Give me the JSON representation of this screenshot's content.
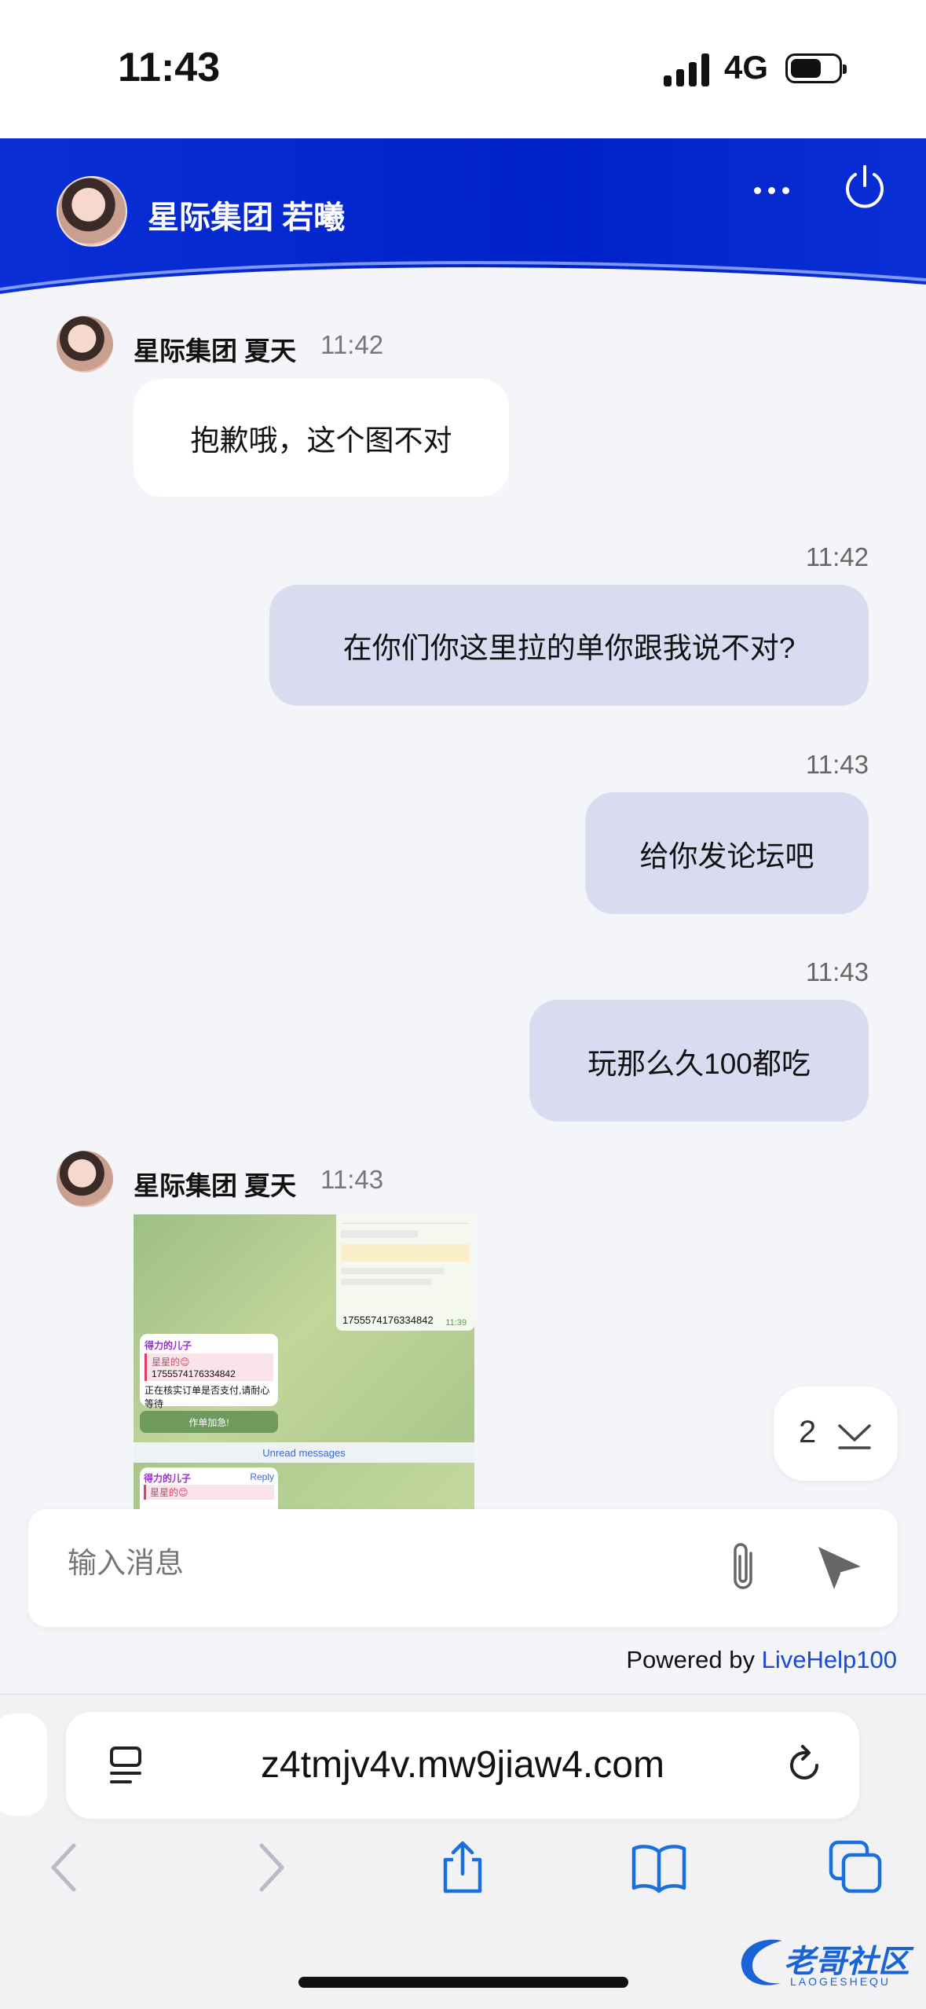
{
  "status_bar": {
    "time": "11:43",
    "network": "4G"
  },
  "header": {
    "title": "星际集团 若曦"
  },
  "messages": [
    {
      "sender": "星际集团 夏天",
      "time": "11:42",
      "text": "抱歉哦，这个图不对"
    },
    {
      "time": "11:42",
      "text": "在你们你这里拉的单你跟我说不对?"
    },
    {
      "time": "11:43",
      "text": "给你发论坛吧"
    },
    {
      "time": "11:43",
      "text": "玩那么久100都吃"
    },
    {
      "sender": "星际集团 夏天",
      "time": "11:43"
    }
  ],
  "image_message": {
    "number": "1755574176334842",
    "card_time": "11:39",
    "group_name": "得力的儿子",
    "quote_name": "星星的😊",
    "quote_number": "1755574176334842",
    "body": "正在核实订单是否支付,请耐心等待",
    "body_number": "1755574176334842",
    "button": "作单加急!",
    "unread": "Unread messages",
    "reply": "Reply"
  },
  "unread_badge": {
    "count": "2"
  },
  "input": {
    "placeholder": "输入消息"
  },
  "footer": {
    "powered_prefix": "Powered by ",
    "powered_link": "LiveHelp100"
  },
  "browser": {
    "url": "z4tmjv4v.mw9jiaw4.com"
  },
  "watermark": {
    "title": "老哥社区",
    "subtitle": "LAOGESHEQU"
  },
  "colors": {
    "header": "#0021c9",
    "outgoing_bubble": "#d9dcf1",
    "link": "#1a4ad6",
    "toolbar_icon": "#1a6fe0"
  }
}
